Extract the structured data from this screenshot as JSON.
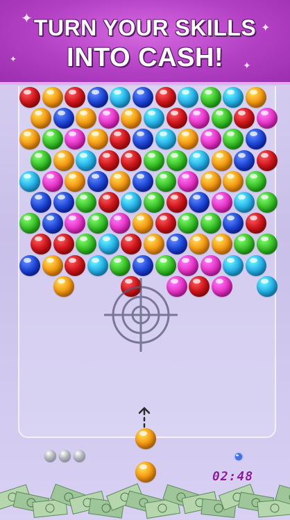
{
  "banner": {
    "line1": "TURN YOUR SKILLS",
    "line2": "INTO CASH!"
  },
  "colors": {
    "red": "#d0171c",
    "orange": "#f59b14",
    "blue": "#1f49d8",
    "cyan": "#2ab4ea",
    "green": "#3cc32a",
    "pink": "#e838c8"
  },
  "board": {
    "rows": [
      [
        "red",
        "orange",
        "red",
        "blue",
        "cyan",
        "blue",
        "red",
        "cyan",
        "green",
        "cyan",
        "orange",
        null
      ],
      [
        "orange",
        "blue",
        "orange",
        "pink",
        "orange",
        "cyan",
        "red",
        "pink",
        "green",
        "red",
        "pink"
      ],
      [
        "orange",
        "green",
        "pink",
        "orange",
        "red",
        "blue",
        "cyan",
        "orange",
        "pink",
        "green",
        "blue",
        null
      ],
      [
        "green",
        "orange",
        "cyan",
        "red",
        "red",
        "green",
        "green",
        "cyan",
        "orange",
        "blue",
        "red"
      ],
      [
        "cyan",
        "pink",
        "orange",
        "blue",
        "orange",
        "blue",
        "green",
        "pink",
        "orange",
        "orange",
        "green",
        null
      ],
      [
        "blue",
        "blue",
        "green",
        "red",
        "cyan",
        "green",
        "red",
        "blue",
        "pink",
        "cyan",
        "green"
      ],
      [
        "green",
        "blue",
        "pink",
        "green",
        "pink",
        "orange",
        "red",
        "green",
        "green",
        "blue",
        "red",
        null
      ],
      [
        "red",
        "red",
        "green",
        "cyan",
        "red",
        "orange",
        "blue",
        "orange",
        "orange",
        "green",
        "green"
      ],
      [
        "blue",
        "orange",
        "red",
        "cyan",
        "green",
        "blue",
        "green",
        "pink",
        "pink",
        "cyan",
        "cyan",
        null
      ],
      [
        null,
        "orange",
        null,
        null,
        "red",
        null,
        "pink",
        "red",
        "pink",
        null,
        "cyan"
      ]
    ]
  },
  "shooter": {
    "current": "orange",
    "next": "orange"
  },
  "lives_remaining": 3,
  "timer": "02:48",
  "icons": {
    "crosshair": "crosshair-icon",
    "arrow": "aim-arrow-icon",
    "bomb": "bomb-icon"
  }
}
